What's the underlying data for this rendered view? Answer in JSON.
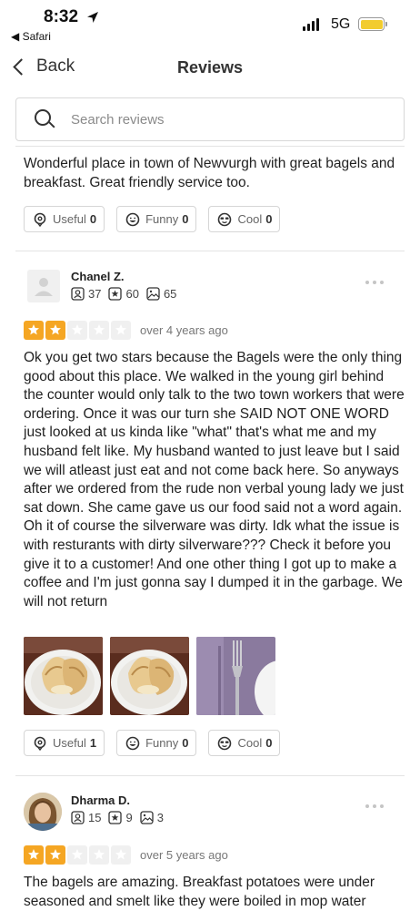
{
  "status_bar": {
    "time": "8:32",
    "back_app": "◀ Safari",
    "network": "5G",
    "battery_color": "#f2cc2f"
  },
  "nav": {
    "back_label": "Back",
    "title": "Reviews"
  },
  "search": {
    "placeholder": "Search reviews",
    "value": ""
  },
  "reviews": [
    {
      "text": "Wonderful place in town of Newvurgh with great bagels and breakfast. Great friendly service too.",
      "actions": {
        "useful_label": "Useful",
        "useful_count": "0",
        "funny_label": "Funny",
        "funny_count": "0",
        "cool_label": "Cool",
        "cool_count": "0"
      }
    },
    {
      "user": {
        "name": "Chanel Z.",
        "friends": "37",
        "reviews": "60",
        "photos": "65",
        "avatar": "default-avatar-icon"
      },
      "rating": 2,
      "date": "over 4 years ago",
      "text": "Ok you get two stars because the Bagels were the only thing good about this place. We walked in the young girl behind the counter would only talk to the two town workers that were ordering. Once it was our turn she SAID NOT ONE WORD just looked at us kinda like \"what\" that's what me and my husband felt like. My husband wanted to just leave but I said we will atleast just eat and not come back here. So anyways after we ordered from the rude non verbal young lady we just sat down. She came gave us our food said not a word again. Oh it of course the silverware was dirty. Idk what the issue is with resturants with dirty silverware??? Check it before you give it to a customer! And one other thing I got up to make a coffee and I'm just gonna say I dumped it in the garbage. We will not return",
      "photos": [
        "bagel-plate-photo",
        "bagel-plate-photo",
        "silverware-photo"
      ],
      "actions": {
        "useful_label": "Useful",
        "useful_count": "1",
        "funny_label": "Funny",
        "funny_count": "0",
        "cool_label": "Cool",
        "cool_count": "0"
      }
    },
    {
      "user": {
        "name": "Dharma D.",
        "friends": "15",
        "reviews": "9",
        "photos": "3",
        "avatar": "user-photo-avatar"
      },
      "rating": 2,
      "date": "over 5 years ago",
      "text": "The bagels are amazing. Breakfast potatoes were under seasoned and smelt like they were boiled in mop water"
    }
  ],
  "colors": {
    "star_on": "#f5a623",
    "star_off": "#f0f0f0"
  }
}
